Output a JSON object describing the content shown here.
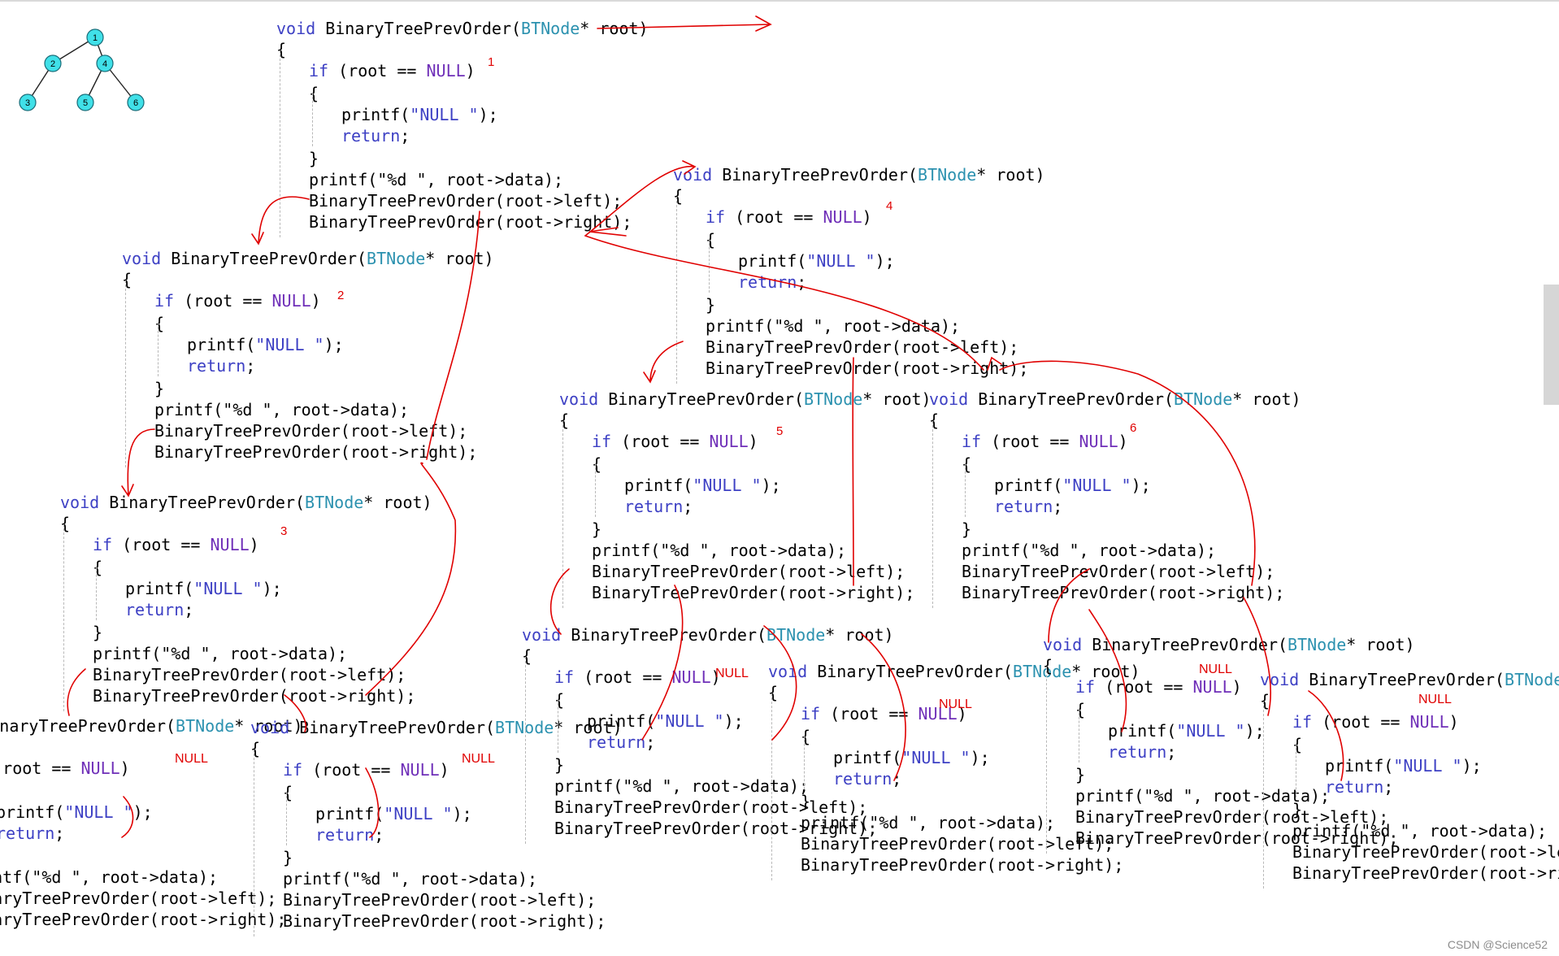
{
  "tree": {
    "nodes": [
      {
        "id": "n1",
        "label": "1"
      },
      {
        "id": "n2",
        "label": "2"
      },
      {
        "id": "n4",
        "label": "4"
      },
      {
        "id": "n3",
        "label": "3"
      },
      {
        "id": "n5",
        "label": "5"
      },
      {
        "id": "n6",
        "label": "6"
      }
    ],
    "edges": [
      [
        "n1",
        "n2"
      ],
      [
        "n1",
        "n4"
      ],
      [
        "n2",
        "n3"
      ],
      [
        "n4",
        "n5"
      ],
      [
        "n4",
        "n6"
      ]
    ],
    "node_color": "#40e0e8",
    "node_stroke": "#1a6c78"
  },
  "code": {
    "signature": "BinaryTreePrevOrder(",
    "kw_void": "void ",
    "type": "BTNode",
    "sig_tail": "* root)",
    "open_brace": "{",
    "close_brace": "}",
    "kw_if": "if ",
    "cond_a": "(root == ",
    "null_macro": "NULL",
    "cond_b": ")",
    "printf_open": "printf(",
    "null_str": "\"NULL \"",
    "printf_close": ");",
    "kw_return": "return",
    "semicolon": ";",
    "printf_data": "printf(\"%d \", root->data);",
    "call_left": "BinaryTreePrevOrder(root->left);",
    "call_right": "BinaryTreePrevOrder(root->right);"
  },
  "annotations": {
    "labels": [
      "1",
      "2",
      "3",
      "4",
      "5",
      "6"
    ],
    "null_mark": "NULL",
    "color": "#e00000"
  },
  "watermark": "CSDN @Science52"
}
